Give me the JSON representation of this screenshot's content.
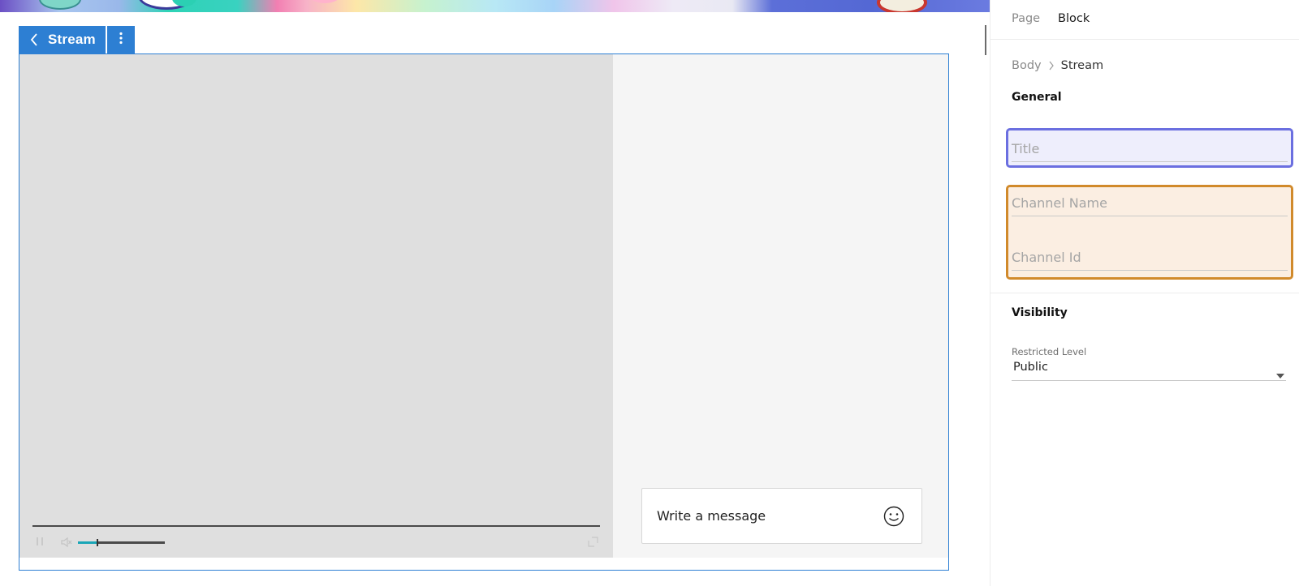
{
  "toolbar": {
    "block_label": "Stream"
  },
  "stream": {
    "message_placeholder": "Write a message",
    "volume_level": 0.22
  },
  "panel": {
    "tabs": [
      {
        "label": "Page",
        "active": false
      },
      {
        "label": "Block",
        "active": true
      }
    ],
    "breadcrumb": [
      "Body",
      "Stream"
    ],
    "general": {
      "title": "General",
      "fields": {
        "title": {
          "placeholder": "Title",
          "value": ""
        },
        "channel_name": {
          "placeholder": "Channel Name",
          "value": ""
        },
        "channel_id": {
          "placeholder": "Channel Id",
          "value": ""
        }
      }
    },
    "visibility": {
      "title": "Visibility",
      "restricted_level": {
        "label": "Restricted Level",
        "value": "Public"
      }
    }
  },
  "colors": {
    "accent": "#2d7fd3",
    "title_highlight": "#6b6fe0",
    "channel_highlight": "#d18a2b"
  }
}
